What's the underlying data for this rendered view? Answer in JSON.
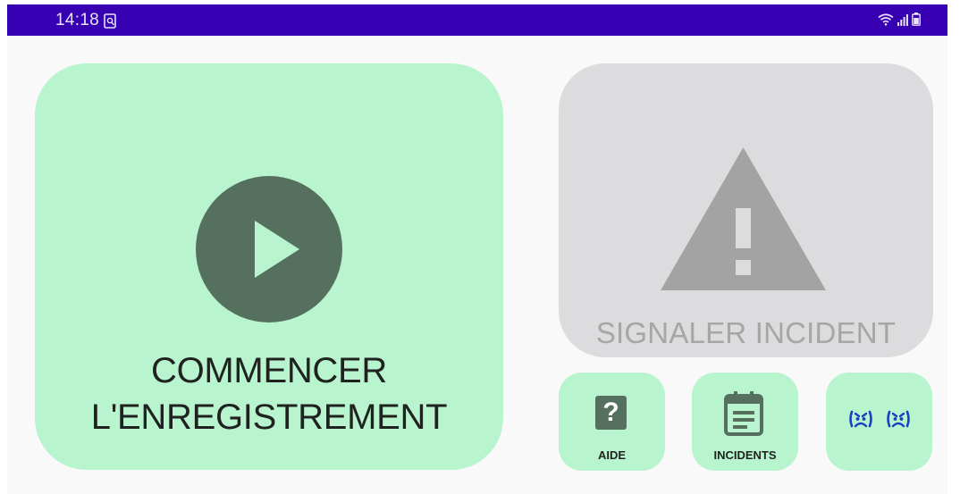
{
  "status_bar": {
    "time": "14:18",
    "notification_icon": "screen-search-icon",
    "right_icons": [
      "wifi-icon",
      "signal-icon",
      "battery-icon"
    ],
    "color": "#3700b3"
  },
  "main": {
    "start": {
      "label": "COMMENCER\nL'ENREGISTREMENT",
      "icon": "play-icon",
      "color": "#b8f5cf"
    },
    "report": {
      "label": "SIGNALER INCIDENT",
      "icon": "warning-icon",
      "color": "#dcdbde"
    },
    "help": {
      "label": "AIDE",
      "icon": "help-icon"
    },
    "incidents": {
      "label": "INCIDENTS",
      "icon": "calendar-icon"
    },
    "mood": {
      "icons": [
        "angry-face-icon",
        "angry-face-icon"
      ]
    }
  }
}
